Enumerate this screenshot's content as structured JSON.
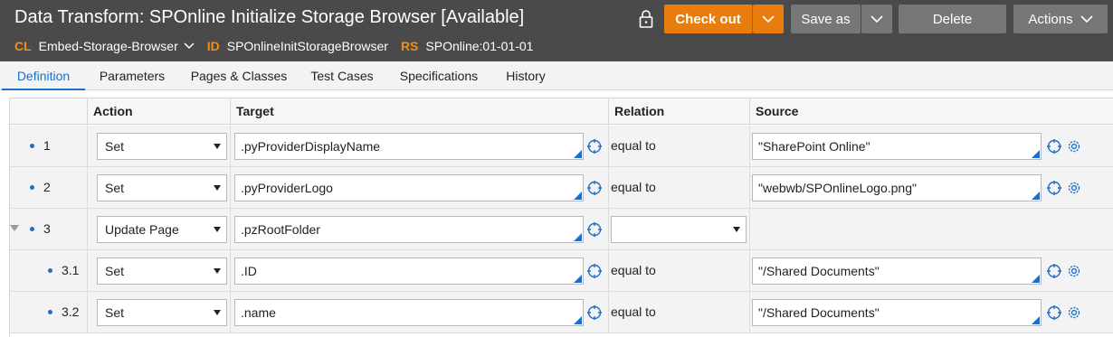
{
  "header": {
    "title": "Data Transform: SPOnline Initialize Storage Browser [Available]",
    "class_tag": "CL",
    "class_value": "Embed-Storage-Browser",
    "id_tag": "ID",
    "id_value": "SPOnlineInitStorageBrowser",
    "rs_tag": "RS",
    "rs_value": "SPOnline:01-01-01",
    "checkout_label": "Check out",
    "saveas_label": "Save as",
    "delete_label": "Delete",
    "actions_label": "Actions",
    "accent_color": "#e87d0d"
  },
  "tabs": [
    "Definition",
    "Parameters",
    "Pages & Classes",
    "Test Cases",
    "Specifications",
    "History"
  ],
  "table": {
    "columns": [
      "Action",
      "Target",
      "Relation",
      "Source"
    ],
    "rows": [
      {
        "num": "1",
        "action": "Set",
        "target": ".pyProviderDisplayName",
        "relation": "equal to",
        "source": "\"SharePoint Online\""
      },
      {
        "num": "2",
        "action": "Set",
        "target": ".pyProviderLogo",
        "relation": "equal to",
        "source": "\"webwb/SPOnlineLogo.png\""
      },
      {
        "num": "3",
        "action": "Update Page",
        "target": ".pzRootFolder",
        "relation": "",
        "source": ""
      },
      {
        "num": "3.1",
        "action": "Set",
        "target": ".ID",
        "relation": "equal to",
        "source": "\"/Shared Documents\""
      },
      {
        "num": "3.2",
        "action": "Set",
        "target": ".name",
        "relation": "equal to",
        "source": "\"/Shared Documents\""
      }
    ]
  }
}
